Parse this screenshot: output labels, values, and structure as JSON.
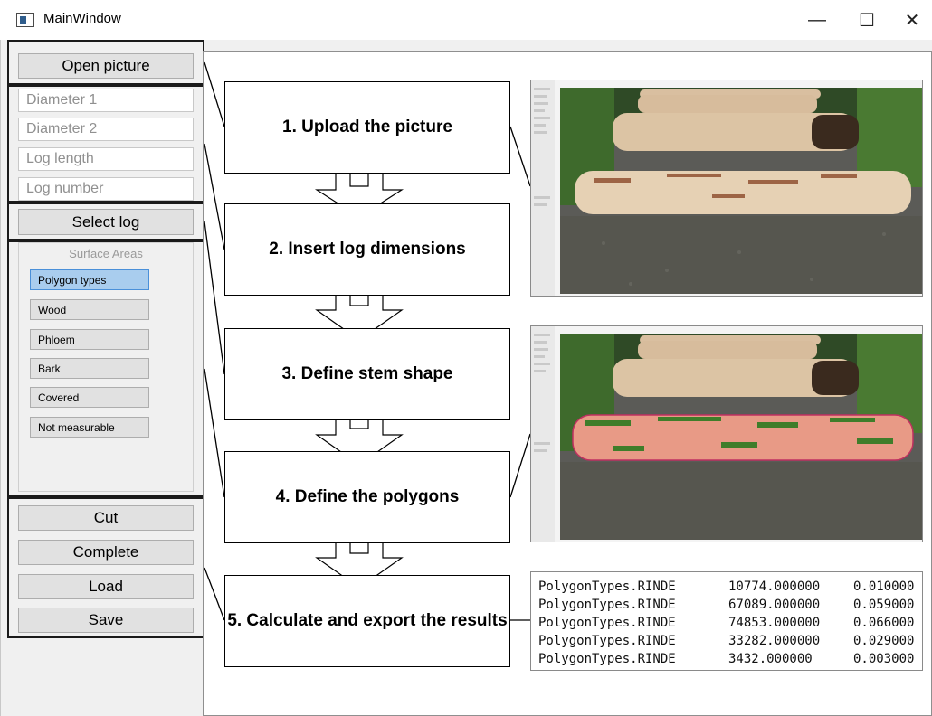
{
  "window": {
    "title": "MainWindow",
    "controls": [
      "—",
      "☐",
      "✕"
    ]
  },
  "left_panel": {
    "open_picture": "Open picture",
    "fields": [
      {
        "placeholder": "Diameter 1"
      },
      {
        "placeholder": "Diameter 2"
      },
      {
        "placeholder": "Log length"
      },
      {
        "placeholder": "Log number"
      }
    ],
    "select_log": "Select log",
    "surface_areas": {
      "title": "Surface Areas",
      "buttons": [
        "Polygon types",
        "Wood",
        "Phloem",
        "Bark",
        "Covered",
        "Not measurable"
      ],
      "selected": "Polygon types"
    },
    "actions": [
      "Cut",
      "Complete",
      "Load",
      "Save"
    ]
  },
  "steps": [
    "1. Upload the picture",
    "2. Insert log dimensions",
    "3. Define stem shape",
    "4. Define the polygons",
    "5. Calculate and export the results"
  ],
  "results": [
    [
      "PolygonTypes.RINDE",
      "10774.000000",
      "0.010000"
    ],
    [
      "PolygonTypes.RINDE",
      "67089.000000",
      "0.059000"
    ],
    [
      "PolygonTypes.RINDE",
      "74853.000000",
      "0.066000"
    ],
    [
      "PolygonTypes.RINDE",
      "33282.000000",
      "0.029000"
    ],
    [
      "PolygonTypes.RINDE",
      "3432.000000",
      "0.003000"
    ]
  ],
  "colors": {
    "selected_button": "#a9cdee",
    "polygon_highlight": "#e89a86",
    "polygon_bark": "#3f7d2a"
  }
}
